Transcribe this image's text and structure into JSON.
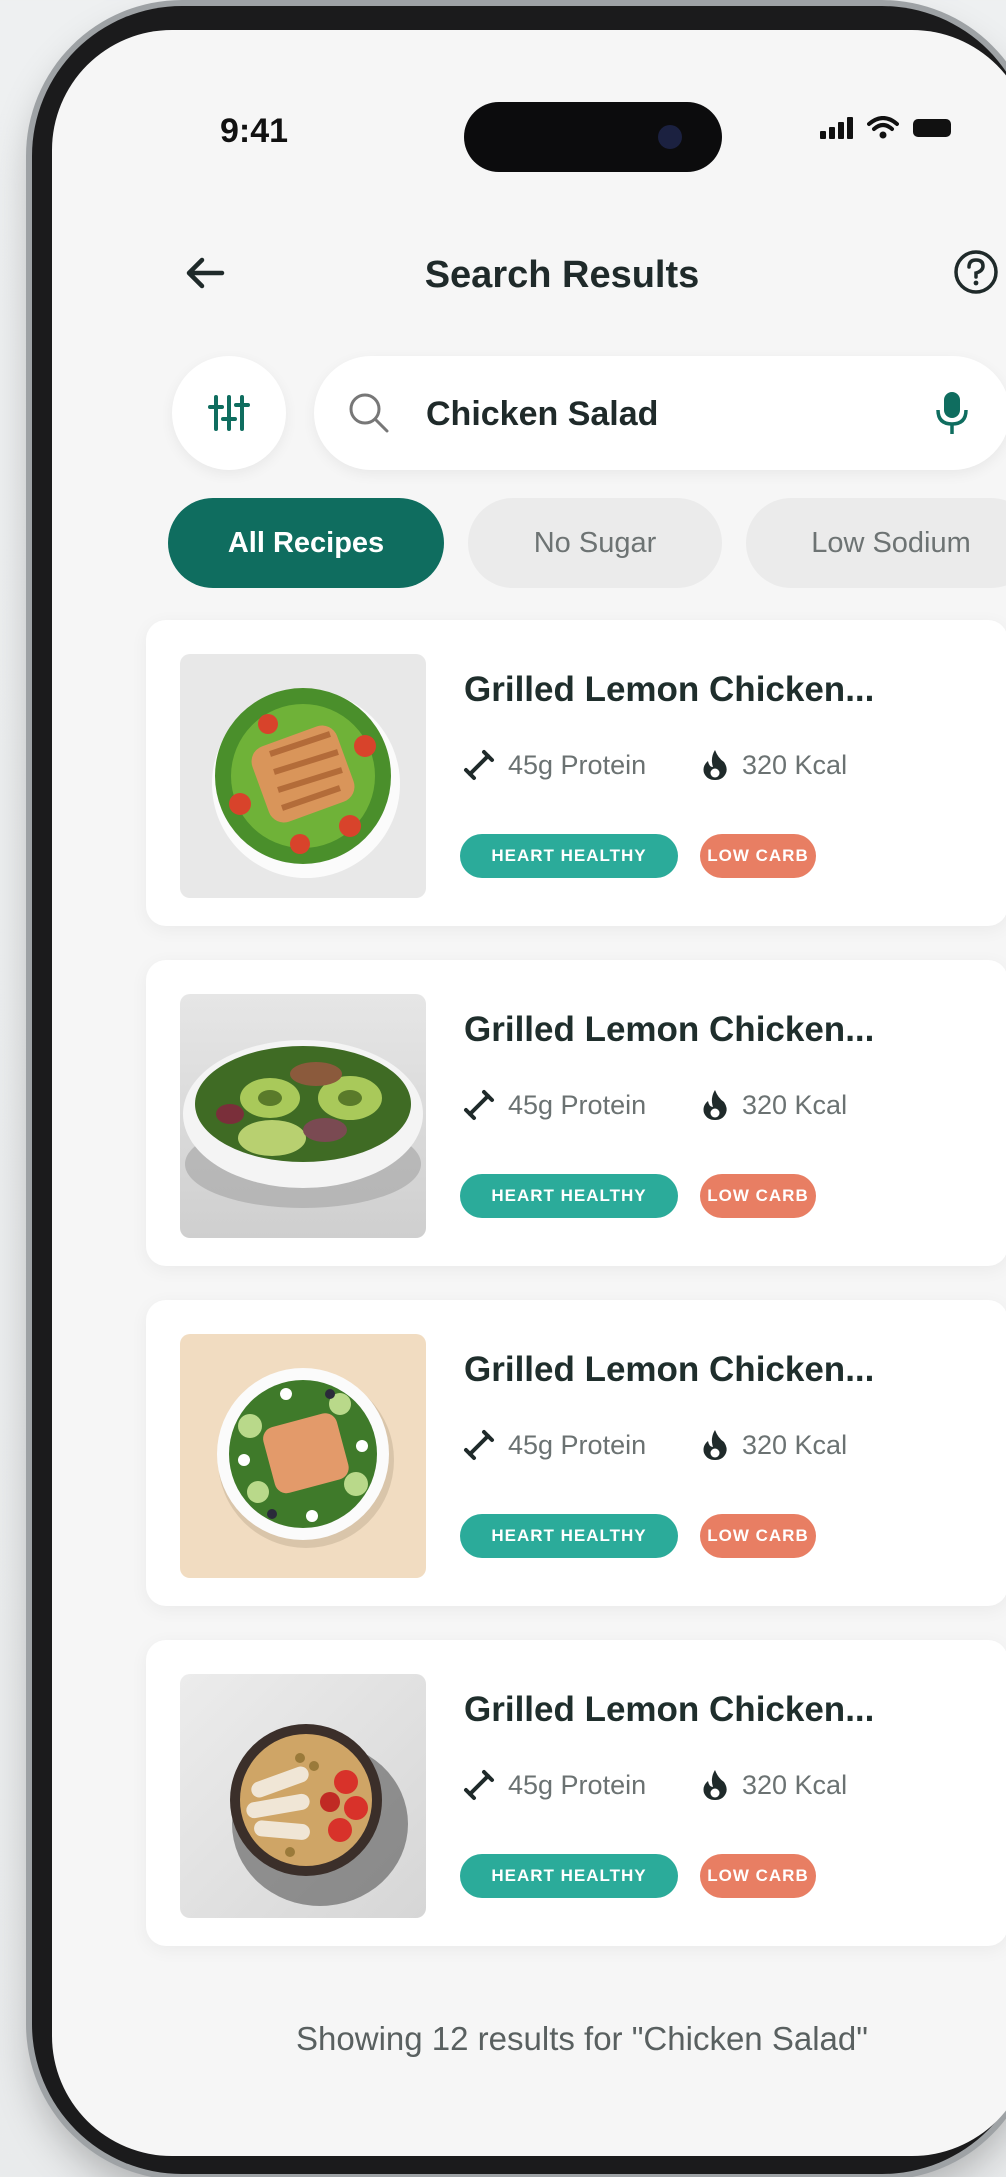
{
  "status_bar": {
    "time": "9:41"
  },
  "header": {
    "title": "Search Results"
  },
  "search": {
    "value": "Chicken Salad"
  },
  "chips": [
    {
      "label": "All Recipes",
      "active": true
    },
    {
      "label": "No Sugar",
      "active": false
    },
    {
      "label": "Low Sodium",
      "active": false
    }
  ],
  "results": [
    {
      "title": "Grilled Lemon Chicken...",
      "protein": "45g Protein",
      "kcal": "320 Kcal",
      "tag1": "HEART HEALTHY",
      "tag2": "LOW CARB"
    },
    {
      "title": "Grilled Lemon Chicken...",
      "protein": "45g Protein",
      "kcal": "320 Kcal",
      "tag1": "HEART HEALTHY",
      "tag2": "LOW CARB"
    },
    {
      "title": "Grilled Lemon Chicken...",
      "protein": "45g Protein",
      "kcal": "320 Kcal",
      "tag1": "HEART HEALTHY",
      "tag2": "LOW CARB"
    },
    {
      "title": "Grilled Lemon Chicken...",
      "protein": "45g Protein",
      "kcal": "320 Kcal",
      "tag1": "HEART HEALTHY",
      "tag2": "LOW CARB"
    }
  ],
  "footer": {
    "summary": "Showing 12 results for \"Chicken Salad\""
  },
  "colors": {
    "primary": "#0f6d5f",
    "heart_tag": "#2bab9a",
    "carb_tag": "#e87e63"
  },
  "icons": [
    "back-arrow-icon",
    "help-icon",
    "filter-sliders-icon",
    "search-icon",
    "microphone-icon",
    "dumbbell-icon",
    "flame-icon"
  ]
}
